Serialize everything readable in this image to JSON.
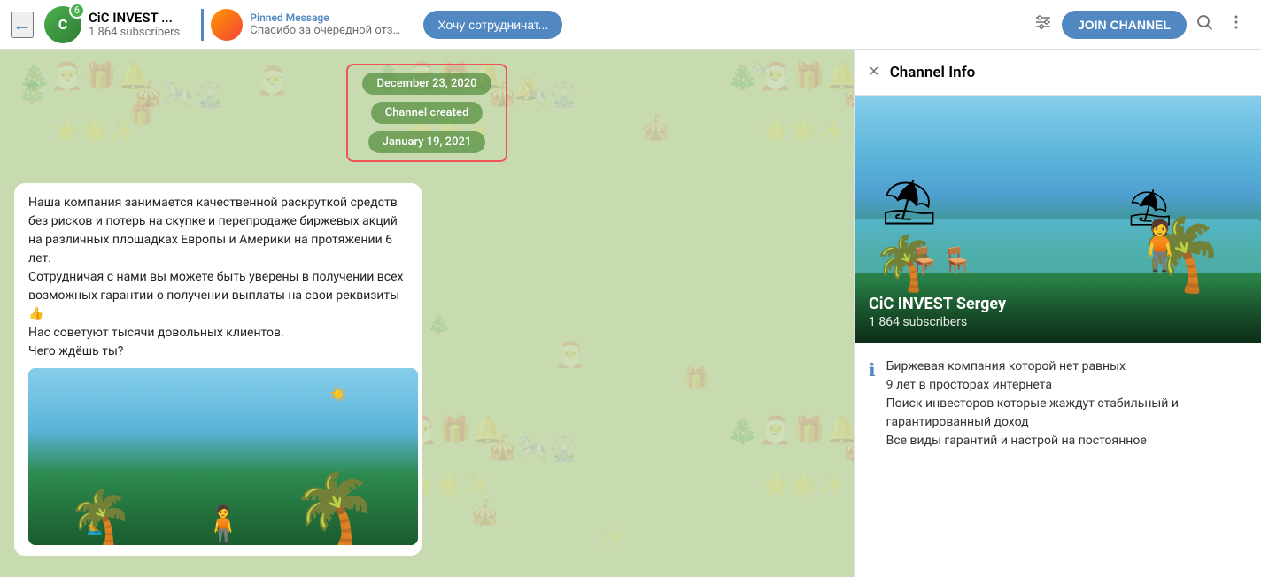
{
  "header": {
    "back_label": "←",
    "channel_name": "CiC INVEST ...",
    "subscribers": "1 864 subscribers",
    "badge_count": "6",
    "pinned_label": "Pinned Message",
    "pinned_preview": "Спасибо за очередной отзы...",
    "collaborate_btn": "Хочу сотрудничат...",
    "join_btn": "JOIN CHANNEL",
    "filter_icon": "⚖",
    "search_icon": "🔍",
    "more_icon": "⋮"
  },
  "chat": {
    "date1": "December 23, 2020",
    "channel_created": "Channel created",
    "date2": "January 19, 2021",
    "message_text": "Наша компания занимается качественной раскруткой средств без рисков и потерь на скупке и перепродаже биржевых акций на различных площадках Европы и Америки на протяжении 6 лет.\nСотрудничая с нами вы можете быть уверены в получении всех возможных гарантии о получении выплаты на свои реквизиты👍\nНас советуют тысячи довольных клиентов.\nЧего ждёшь ты?"
  },
  "panel": {
    "title": "Channel Info",
    "close_icon": "×",
    "channel_name": "CiC INVEST Sergey",
    "subscribers": "1 864 subscribers",
    "description_line1": "Биржевая компания которой нет равных",
    "description_line2": "9 лет в просторах интернета",
    "description_line3": "Поиск инвесторов которые жаждут стабильный и гарантированный доход",
    "description_line4": "Все виды гарантий и настрой на постоянное"
  }
}
